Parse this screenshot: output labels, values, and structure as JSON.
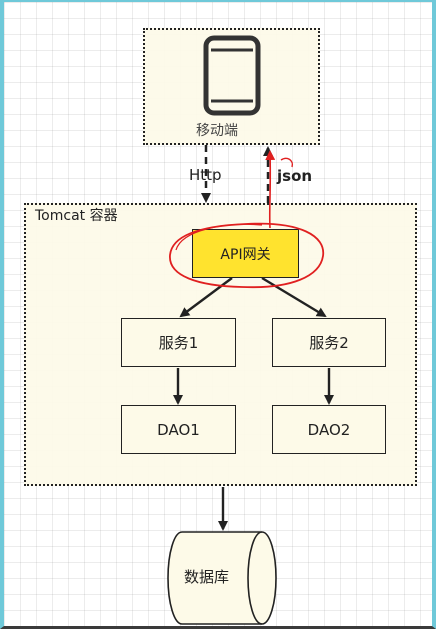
{
  "diagram": {
    "client": {
      "label": "移动端",
      "icon": "phone-icon"
    },
    "edge_request": {
      "label": "Http"
    },
    "edge_response": {
      "label": "json"
    },
    "container": {
      "label": "Tomcat 容器"
    },
    "gateway": {
      "label": "API网关",
      "color": "#ffe32e",
      "highlight_color": "#e02020"
    },
    "services": [
      {
        "label": "服务1"
      },
      {
        "label": "服务2"
      }
    ],
    "daos": [
      {
        "label": "DAO1"
      },
      {
        "label": "DAO2"
      }
    ],
    "database": {
      "label": "数据库"
    },
    "colors": {
      "frame_border": "#6fc9d9",
      "node_fill": "#fdfae8",
      "annotation": "#e02020"
    }
  }
}
